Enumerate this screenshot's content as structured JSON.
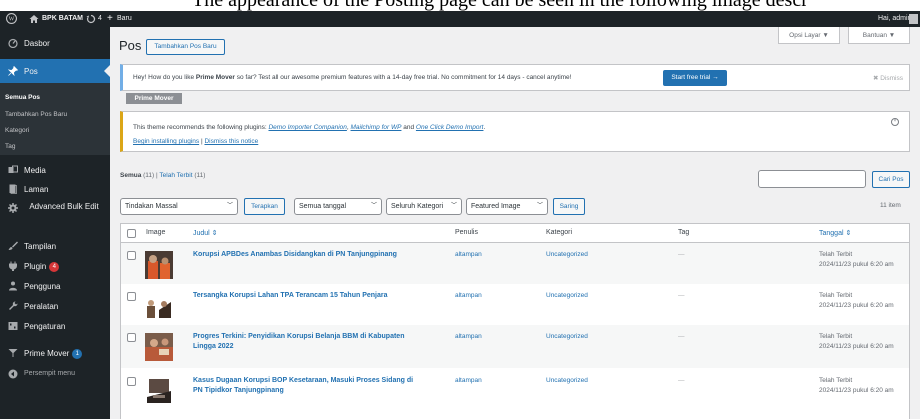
{
  "caption": "The appearance of the Posting page can be seen in the following image descr",
  "adminbar": {
    "site_name": "BPK BATAM",
    "updates": "4",
    "new_label": "Baru",
    "greeting": "Hai, admin"
  },
  "sidebar": {
    "items": [
      {
        "label": "Dasbor",
        "icon": "dashboard-icon"
      },
      {
        "label": "Pos",
        "icon": "pin-icon"
      },
      {
        "label": "Media",
        "icon": "media-icon"
      },
      {
        "label": "Laman",
        "icon": "page-icon"
      },
      {
        "label": "Advanced Bulk Edit",
        "icon": "gear-icon"
      },
      {
        "label": "Tampilan",
        "icon": "brush-icon"
      },
      {
        "label": "Plugin",
        "icon": "plugin-icon",
        "badge": "4"
      },
      {
        "label": "Pengguna",
        "icon": "users-icon"
      },
      {
        "label": "Peralatan",
        "icon": "wrench-icon"
      },
      {
        "label": "Pengaturan",
        "icon": "settings-icon"
      },
      {
        "label": "Prime Mover",
        "icon": "prime-mover-icon",
        "badge": "1"
      },
      {
        "label": "Persempit menu",
        "icon": "collapse-icon"
      }
    ],
    "submenu": [
      "Semua Pos",
      "Tambahkan Pos Baru",
      "Kategori",
      "Tag"
    ]
  },
  "header": {
    "title": "Pos",
    "add_new": "Tambahkan Pos Baru",
    "screen_options": "Opsi Layar ▼",
    "help": "Bantuan ▼"
  },
  "notice1": {
    "text_pre": "Hey! How do you like ",
    "text_bold": "Prime Mover",
    "text_post": " so far? Test all our awesome premium features with a 14-day free trial. No commitment for 14 days - cancel anytime!",
    "trial_button": "Start free trial →",
    "dismiss": "✖ Dismiss",
    "tag": "Prime Mover"
  },
  "notice2": {
    "text_pre": "This theme recommends the following plugins: ",
    "link1": "Demo Importer Companion",
    "sep1": ", ",
    "link2": "Mailchimp for WP",
    "sep2": " and ",
    "link3": "One Click Demo Import",
    "text_post": ".",
    "begin": "Begin installing plugins",
    "sep3": " | ",
    "dismiss": "Dismiss this notice"
  },
  "filters": {
    "all": "Semua",
    "all_count": " (11) | ",
    "published": "Telah Terbit",
    "published_count": " (11)",
    "search_button": "Cari Pos",
    "bulk_action": "Tindakan Massal",
    "apply": "Terapkan",
    "all_dates": "Semua tanggal",
    "all_categories": "Seluruh Kategori",
    "featured_image": "Featured Image",
    "filter": "Saring",
    "items_count": "11 item"
  },
  "table": {
    "headers": [
      "Image",
      "Judul ⇕",
      "Penulis",
      "Kategori",
      "Tag",
      "Tanggal ⇕"
    ],
    "rows": [
      {
        "title": "Korupsi APBDes Anambas Disidangkan di PN Tanjungpinang",
        "title2": "",
        "author": "altampan",
        "category": "Uncategorized",
        "tag": "—",
        "status": "Telah Terbit",
        "date": "2024/11/23 pukul 6:20 am"
      },
      {
        "title": "Tersangka Korupsi Lahan TPA Terancam 15 Tahun Penjara",
        "title2": "",
        "author": "altampan",
        "category": "Uncategorized",
        "tag": "—",
        "status": "Telah Terbit",
        "date": "2024/11/23 pukul 6:20 am"
      },
      {
        "title": "Progres Terkini: Penyidikan Korupsi Belanja BBM di Kabupaten",
        "title2": "Lingga 2022",
        "author": "altampan",
        "category": "Uncategorized",
        "tag": "—",
        "status": "Telah Terbit",
        "date": "2024/11/23 pukul 6:20 am"
      },
      {
        "title": "Kasus Dugaan Korupsi BOP Kesetaraan, Masuki Proses Sidang di",
        "title2": "PN Tipidkor Tanjungpinang",
        "author": "altampan",
        "category": "Uncategorized",
        "tag": "—",
        "status": "Telah Terbit",
        "date": "2024/11/23 pukul 6:20 am"
      }
    ]
  }
}
